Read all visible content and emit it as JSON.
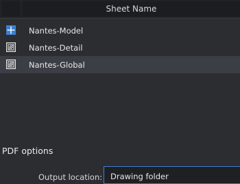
{
  "table": {
    "header": {
      "sheet_name_label": "Sheet Name"
    },
    "rows": [
      {
        "icon": "model-sheet-icon",
        "label": "Nantes-Model",
        "selected": false
      },
      {
        "icon": "layout-sheet-icon",
        "label": "Nantes-Detail",
        "selected": false
      },
      {
        "icon": "layout-sheet-icon",
        "label": "Nantes-Global",
        "selected": true
      }
    ]
  },
  "pdf_options": {
    "title": "PDF options",
    "output_location_label": "Output location:",
    "output_location_value": "Drawing folder"
  },
  "colors": {
    "background": "#2b2d31",
    "header": "#1c1d21",
    "selected_row": "#3b3e44",
    "accent": "#3d7fd0"
  }
}
